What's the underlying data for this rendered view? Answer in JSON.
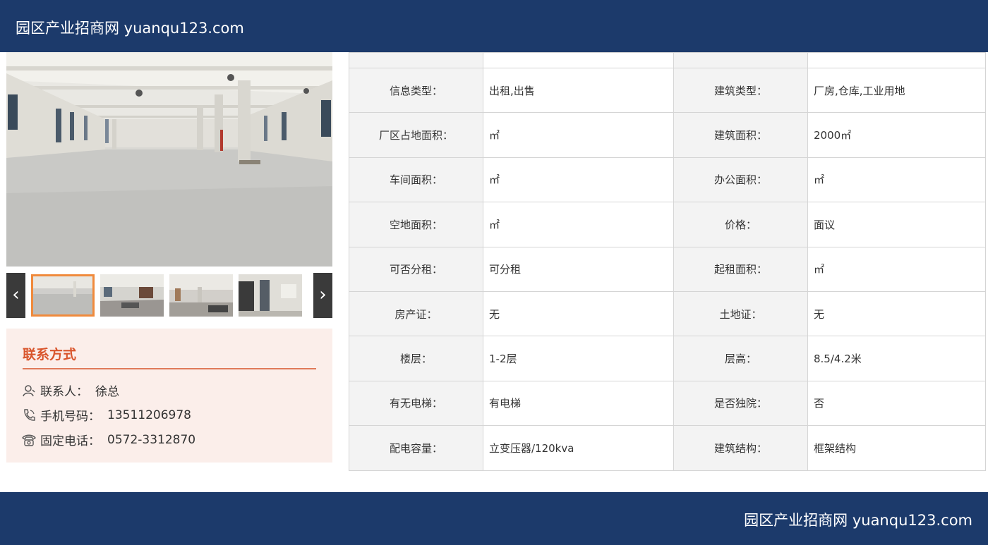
{
  "header": {
    "brand": "园区产业招商网 yuanqu123.com"
  },
  "footer": {
    "brand": "园区产业招商网 yuanqu123.com"
  },
  "gallery": {
    "prev_label": "‹",
    "next_label": "›",
    "thumbnails": [
      "thumb-1",
      "thumb-2",
      "thumb-3",
      "thumb-4"
    ],
    "active_index": 0
  },
  "contact": {
    "title": "联系方式",
    "person_label": "联系人：",
    "person": "徐总",
    "mobile_label": "手机号码：",
    "mobile": "13511206978",
    "phone_label": "固定电话：",
    "phone": "0572-3312870",
    "accent_color": "#d9552c"
  },
  "details": {
    "rows": [
      {
        "k1": "信息类型：",
        "v1": "出租,出售",
        "k2": "建筑类型：",
        "v2": "厂房,仓库,工业用地"
      },
      {
        "k1": "厂区占地面积：",
        "v1": "㎡",
        "k2": "建筑面积：",
        "v2": "2000㎡"
      },
      {
        "k1": "车间面积：",
        "v1": "㎡",
        "k2": "办公面积：",
        "v2": "㎡"
      },
      {
        "k1": "空地面积：",
        "v1": "㎡",
        "k2": "价格：",
        "v2": "面议"
      },
      {
        "k1": "可否分租：",
        "v1": "可分租",
        "k2": "起租面积：",
        "v2": "㎡"
      },
      {
        "k1": "房产证：",
        "v1": "无",
        "k2": "土地证：",
        "v2": "无"
      },
      {
        "k1": "楼层：",
        "v1": "1-2层",
        "k2": "层高：",
        "v2": "8.5/4.2米"
      },
      {
        "k1": "有无电梯：",
        "v1": "有电梯",
        "k2": "是否独院：",
        "v2": "否"
      },
      {
        "k1": "配电容量：",
        "v1": "立变压器/120kva",
        "k2": "建筑结构：",
        "v2": "框架结构"
      }
    ]
  },
  "colors": {
    "banner": "#1c3a6b",
    "label_bg": "#f3f3f3",
    "thumb_active": "#f08a3c"
  }
}
